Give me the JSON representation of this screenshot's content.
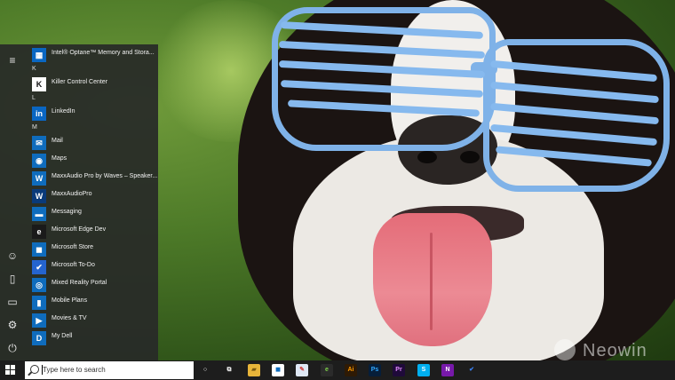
{
  "start_menu": {
    "rail": [
      {
        "name": "hamburger-menu-icon",
        "glyph": "≡"
      },
      {
        "name": "user-avatar-icon",
        "glyph": "☺"
      },
      {
        "name": "documents-icon",
        "glyph": "▯"
      },
      {
        "name": "pictures-icon",
        "glyph": "▭"
      },
      {
        "name": "settings-icon",
        "glyph": "⚙"
      },
      {
        "name": "power-icon",
        "glyph": "⏻"
      }
    ],
    "items": [
      {
        "type": "app",
        "label": "Intel® Optane™ Memory and Stora...",
        "icon": "intel-optane-icon",
        "tile": "▦",
        "color": "#0a67c2"
      },
      {
        "type": "letter",
        "label": "K"
      },
      {
        "type": "app",
        "label": "Killer Control Center",
        "icon": "killer-icon",
        "tile": "K",
        "color": "#ffffff"
      },
      {
        "type": "letter",
        "label": "L"
      },
      {
        "type": "app",
        "label": "LinkedIn",
        "icon": "linkedin-icon",
        "tile": "in",
        "color": "#0a66c2"
      },
      {
        "type": "letter",
        "label": "M"
      },
      {
        "type": "app",
        "label": "Mail",
        "icon": "mail-icon",
        "tile": "✉",
        "color": "#0f6cbd"
      },
      {
        "type": "app",
        "label": "Maps",
        "icon": "maps-icon",
        "tile": "◉",
        "color": "#0f6cbd"
      },
      {
        "type": "app",
        "label": "MaxxAudio Pro by Waves – Speaker...",
        "icon": "maxxaudio-icon",
        "tile": "W",
        "color": "#0f6cbd"
      },
      {
        "type": "app",
        "label": "MaxxAudioPro",
        "icon": "maxxaudiopro-icon",
        "tile": "W",
        "color": "#0a3a7a"
      },
      {
        "type": "app",
        "label": "Messaging",
        "icon": "messaging-icon",
        "tile": "▬",
        "color": "#0f6cbd"
      },
      {
        "type": "app",
        "label": "Microsoft Edge Dev",
        "icon": "edge-dev-icon",
        "tile": "e",
        "color": "#1a1a1a"
      },
      {
        "type": "app",
        "label": "Microsoft Store",
        "icon": "store-icon",
        "tile": "◼",
        "color": "#0f6cbd"
      },
      {
        "type": "app",
        "label": "Microsoft To-Do",
        "icon": "todo-icon",
        "tile": "✔",
        "color": "#2564cf"
      },
      {
        "type": "app",
        "label": "Mixed Reality Portal",
        "icon": "mixed-reality-icon",
        "tile": "◎",
        "color": "#0f6cbd"
      },
      {
        "type": "app",
        "label": "Mobile Plans",
        "icon": "mobile-plans-icon",
        "tile": "▮",
        "color": "#0f6cbd"
      },
      {
        "type": "app",
        "label": "Movies & TV",
        "icon": "movies-tv-icon",
        "tile": "▶",
        "color": "#0f6cbd"
      },
      {
        "type": "app",
        "label": "My Dell",
        "icon": "my-dell-icon",
        "tile": "D",
        "color": "#0f6cbd"
      }
    ]
  },
  "taskbar": {
    "search_placeholder": "Type here to search",
    "icons": [
      {
        "name": "cortana-icon",
        "glyph": "○",
        "bg": "transparent",
        "fg": "#ffffff"
      },
      {
        "name": "task-view-icon",
        "glyph": "⧉",
        "bg": "transparent",
        "fg": "#ffffff"
      },
      {
        "name": "file-explorer-icon",
        "glyph": "▰",
        "bg": "#e8b53a",
        "fg": "#7a5a10"
      },
      {
        "name": "store-taskbar-icon",
        "glyph": "◼",
        "bg": "#ffffff",
        "fg": "#0f6cbd"
      },
      {
        "name": "paint-icon",
        "glyph": "✎",
        "bg": "#dfe8f5",
        "fg": "#c44"
      },
      {
        "name": "edge-dev-taskbar-icon",
        "glyph": "e",
        "bg": "#2b2b2b",
        "fg": "#7ed14a"
      },
      {
        "name": "illustrator-icon",
        "glyph": "Ai",
        "bg": "#2e1a05",
        "fg": "#ff9a00"
      },
      {
        "name": "photoshop-icon",
        "glyph": "Ps",
        "bg": "#061e3a",
        "fg": "#31a8ff"
      },
      {
        "name": "premiere-icon",
        "glyph": "Pr",
        "bg": "#1f0a3a",
        "fg": "#e38cff"
      },
      {
        "name": "skype-icon",
        "glyph": "S",
        "bg": "#00aff0",
        "fg": "#ffffff"
      },
      {
        "name": "onenote-icon",
        "glyph": "N",
        "bg": "#7719aa",
        "fg": "#ffffff"
      },
      {
        "name": "todo-taskbar-icon",
        "glyph": "✔",
        "bg": "transparent",
        "fg": "#3b82f6"
      }
    ]
  },
  "watermark": {
    "text": "Neowin"
  }
}
